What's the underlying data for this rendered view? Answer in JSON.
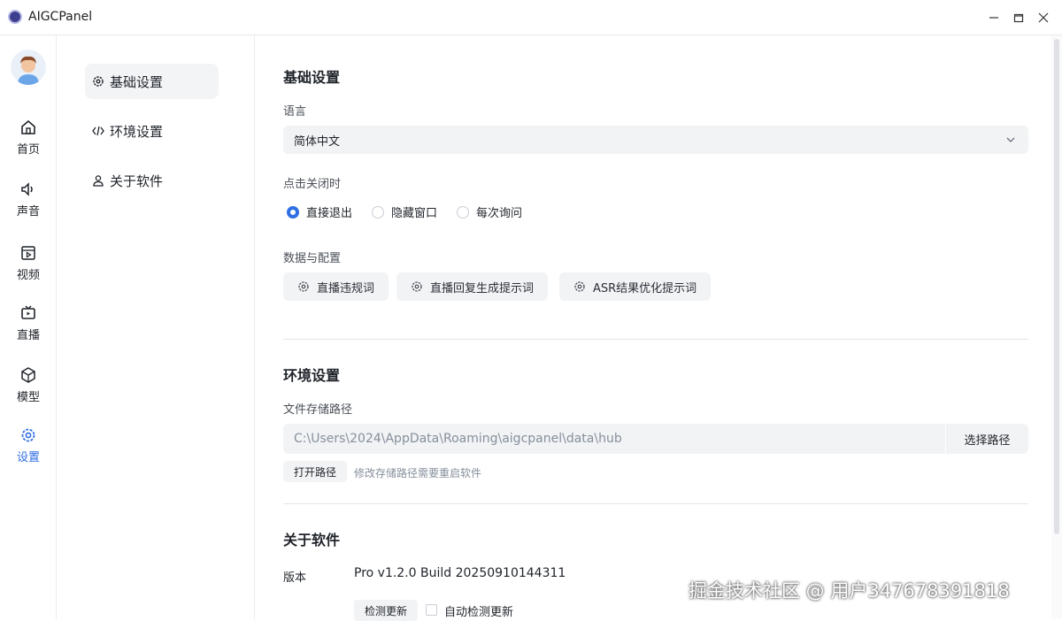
{
  "window": {
    "title": "AIGCPanel"
  },
  "rail": {
    "items": [
      {
        "label": "首页"
      },
      {
        "label": "声音"
      },
      {
        "label": "视频"
      },
      {
        "label": "直播"
      },
      {
        "label": "模型"
      },
      {
        "label": "设置"
      }
    ]
  },
  "subnav": {
    "items": [
      {
        "label": "基础设置"
      },
      {
        "label": "环境设置"
      },
      {
        "label": "关于软件"
      }
    ]
  },
  "basic": {
    "title": "基础设置",
    "language_label": "语言",
    "language_value": "简体中文",
    "close_label": "点击关闭时",
    "close_options": [
      "直接退出",
      "隐藏窗口",
      "每次询问"
    ],
    "data_label": "数据与配置",
    "data_buttons": [
      "直播违规词",
      "直播回复生成提示词",
      "ASR结果优化提示词"
    ]
  },
  "env": {
    "title": "环境设置",
    "path_label": "文件存储路径",
    "path_value": "C:\\Users\\2024\\AppData\\Roaming\\aigcpanel\\data\\hub",
    "choose_path": "选择路径",
    "open_path": "打开路径",
    "hint": "修改存储路径需要重启软件"
  },
  "about": {
    "title": "关于软件",
    "version_label": "版本",
    "version_value": "Pro v1.2.0 Build 20250910144311",
    "check_update": "检测更新",
    "auto_check": "自动检测更新"
  },
  "watermark": "掘金技术社区 @ 用户347678391818",
  "colors": {
    "accent": "#2f6fe4",
    "field_bg": "#f2f3f5"
  }
}
